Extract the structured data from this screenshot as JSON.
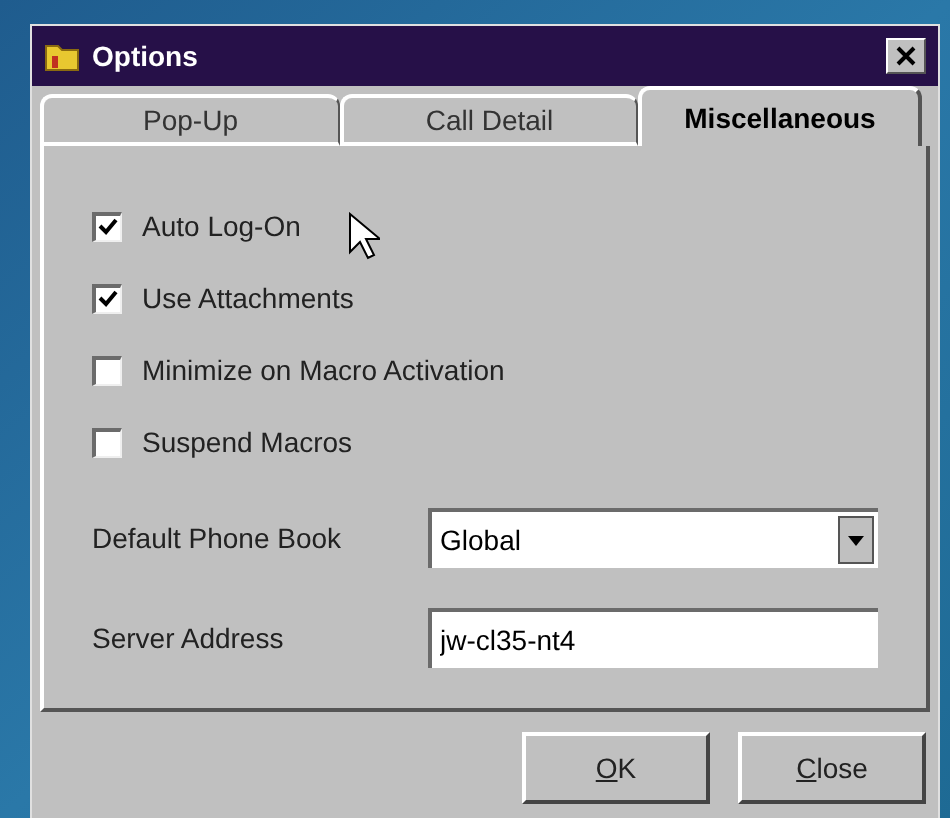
{
  "window": {
    "title": "Options"
  },
  "tabs": [
    {
      "label": "Pop-Up",
      "selected": false
    },
    {
      "label": "Call Detail",
      "selected": false
    },
    {
      "label": "Miscellaneous",
      "selected": true
    }
  ],
  "options": [
    {
      "label": "Auto Log-On",
      "checked": true
    },
    {
      "label": "Use Attachments",
      "checked": true
    },
    {
      "label": "Minimize on Macro Activation",
      "checked": false
    },
    {
      "label": "Suspend Macros",
      "checked": false
    }
  ],
  "phone_book": {
    "label": "Default Phone Book",
    "value": "Global"
  },
  "server": {
    "label": "Server Address",
    "value": "jw-cl35-nt4"
  },
  "buttons": [
    "OK",
    "Close"
  ]
}
